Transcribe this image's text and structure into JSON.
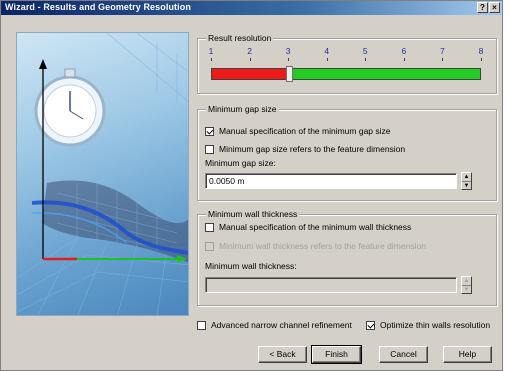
{
  "window": {
    "title": "Wizard - Results and Geometry Resolution",
    "help_glyph": "?",
    "close_glyph": "×"
  },
  "result_resolution": {
    "title": "Result resolution",
    "levels": [
      "1",
      "2",
      "3",
      "4",
      "5",
      "6",
      "7",
      "8"
    ],
    "current_level": 3,
    "max_level": 8,
    "colors": {
      "low": "#ee1a1a",
      "high": "#22cc22"
    }
  },
  "min_gap": {
    "title": "Minimum gap size",
    "manual_label": "Manual specification of the minimum gap size",
    "manual_checked": true,
    "refers_label": "Minimum gap size refers to the feature dimension",
    "refers_checked": false,
    "field_label": "Minimum gap size:",
    "field_value": "0.0050 m"
  },
  "min_wall": {
    "title": "Minimum wall thickness",
    "manual_label": "Manual specification of the minimum wall thickness",
    "manual_checked": false,
    "refers_label": "Minimum wall thickness refers to the feature dimension",
    "refers_checked": false,
    "field_label": "Minimum wall thickness:",
    "field_value": ""
  },
  "options": {
    "narrow_label": "Advanced narrow channel refinement",
    "narrow_checked": false,
    "thin_walls_label": "Optimize thin walls resolution",
    "thin_walls_checked": true
  },
  "buttons": {
    "back": "< Back",
    "finish": "Finish",
    "cancel": "Cancel",
    "help": "Help"
  },
  "spin_glyphs": {
    "up": "▲",
    "down": "▼"
  }
}
